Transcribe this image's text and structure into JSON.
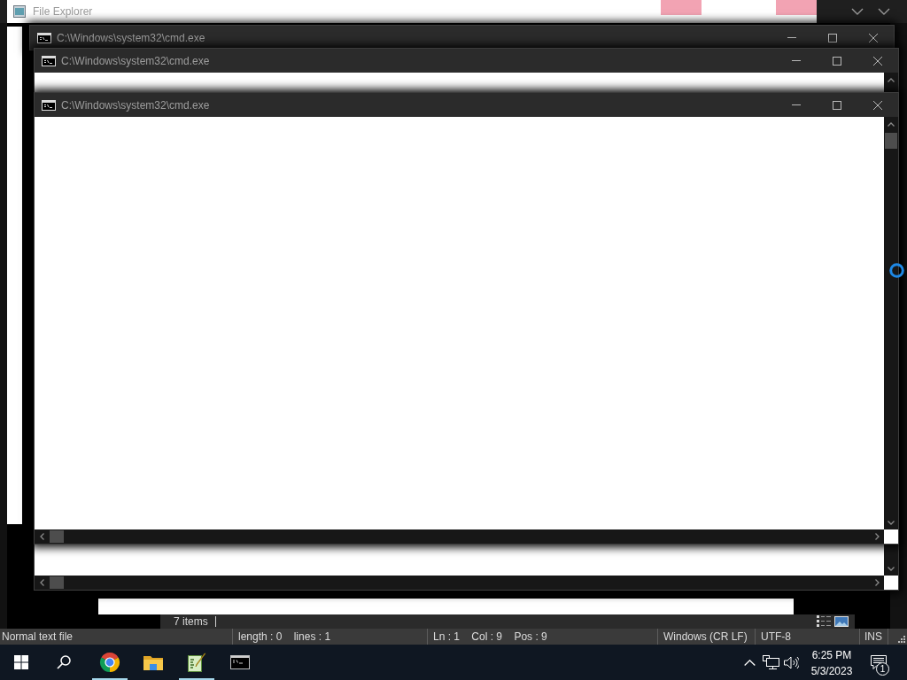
{
  "file_explorer": {
    "title": "File Explorer",
    "status_bar": {
      "item_count": "7 items"
    }
  },
  "cmd_windows": [
    {
      "title": "C:\\Windows\\system32\\cmd.exe"
    },
    {
      "title": "C:\\Windows\\system32\\cmd.exe"
    },
    {
      "title": "C:\\Windows\\system32\\cmd.exe"
    }
  ],
  "editor_window": {
    "status_bar": {
      "fields": [
        "Normal text file",
        "length : 0    lines : 1",
        "Ln : 1    Col : 9    Pos : 9",
        "Windows (CR LF)",
        "UTF-8",
        "INS"
      ]
    }
  },
  "taskbar": {
    "apps": [
      {
        "kind": "browser",
        "running": true
      },
      {
        "kind": "folder",
        "running": false
      },
      {
        "kind": "notepad",
        "running": true
      },
      {
        "kind": "terminal",
        "running": false
      }
    ],
    "tray": {
      "time": "6:25 PM",
      "date": "5/3/2023",
      "notification_count": "1"
    }
  }
}
